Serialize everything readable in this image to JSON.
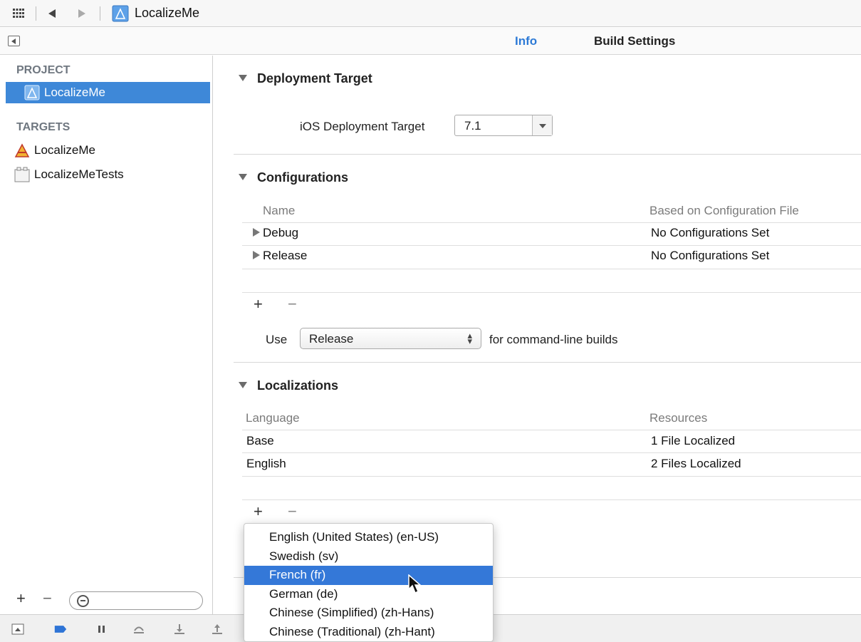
{
  "topbar": {
    "title": "LocalizeMe",
    "icons": [
      "grid-icon",
      "back-arrow-icon",
      "forward-arrow-icon",
      "project-icon"
    ]
  },
  "tabs": [
    {
      "label": "Info",
      "active": true
    },
    {
      "label": "Build Settings",
      "active": false
    }
  ],
  "sidebar": {
    "project_heading": "PROJECT",
    "project_item": "LocalizeMe",
    "targets_heading": "TARGETS",
    "targets": [
      "LocalizeMe",
      "LocalizeMeTests"
    ],
    "footer": {
      "add": "+",
      "remove": "−"
    }
  },
  "deployment": {
    "section_title": "Deployment Target",
    "label": "iOS Deployment Target",
    "value": "7.1"
  },
  "configurations": {
    "section_title": "Configurations",
    "columns": [
      "Name",
      "Based on Configuration File"
    ],
    "rows": [
      {
        "name": "Debug",
        "file": "No Configurations Set"
      },
      {
        "name": "Release",
        "file": "No Configurations Set"
      }
    ],
    "add": "+",
    "remove": "−",
    "use_label": "Use",
    "use_value": "Release",
    "use_suffix": "for command-line builds"
  },
  "localizations": {
    "section_title": "Localizations",
    "columns": [
      "Language",
      "Resources"
    ],
    "rows": [
      {
        "language": "Base",
        "resources": "1 File Localized"
      },
      {
        "language": "English",
        "resources": "2 Files Localized"
      }
    ],
    "add": "+",
    "remove": "−"
  },
  "language_menu": {
    "items": [
      "English (United States) (en-US)",
      "Swedish (sv)",
      "French (fr)",
      "German (de)",
      "Chinese (Simplified) (zh-Hans)",
      "Chinese (Traditional) (zh-Hant)"
    ],
    "selected": "French (fr)"
  },
  "colors": {
    "accent": "#2d7ad6",
    "selection": "#3e88d8",
    "menu_selection": "#3478d8"
  }
}
